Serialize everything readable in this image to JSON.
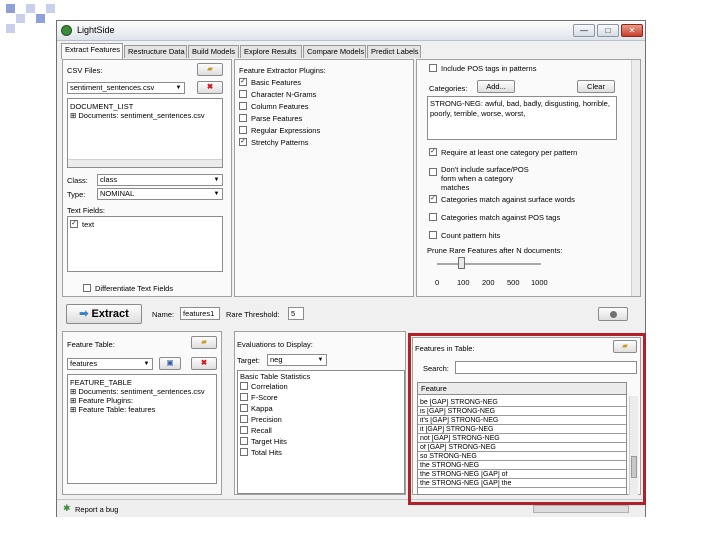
{
  "window": {
    "title": "LightSide",
    "btn_min": "—",
    "btn_max": "□",
    "btn_close": "✕"
  },
  "tabs": [
    "Extract Features",
    "Restructure Data",
    "Build Models",
    "Explore Results",
    "Compare Models",
    "Predict Labels"
  ],
  "left": {
    "csv_label": "CSV Files:",
    "csv_selected": "sentiment_sentences.csv",
    "doc_list": [
      "DOCUMENT_LIST",
      "Documents: sentiment_sentences.csv"
    ],
    "class_label": "Class:",
    "class_value": "class",
    "type_label": "Type:",
    "type_value": "NOMINAL",
    "text_fields_label": "Text Fields:",
    "text_field_item": "text",
    "differentiate": "Differentiate Text Fields"
  },
  "plugins": {
    "label": "Feature Extractor Plugins:",
    "items": [
      {
        "label": "Basic Features",
        "checked": true
      },
      {
        "label": "Character N-Grams",
        "checked": false
      },
      {
        "label": "Column Features",
        "checked": false
      },
      {
        "label": "Parse Features",
        "checked": false
      },
      {
        "label": "Regular Expressions",
        "checked": false
      },
      {
        "label": "Stretchy Patterns",
        "checked": true
      }
    ]
  },
  "right": {
    "include_pos": "Include POS tags in patterns",
    "categories_label": "Categories:",
    "add_label": "Add...",
    "clear_label": "Clear",
    "categories_text": "STRONG-NEG: awful, bad, badly, disgusting, horrible, poorly, terrible, worse, worst,",
    "options": [
      {
        "label": "Require at least one category per pattern",
        "checked": true
      },
      {
        "label": "Don't include surface/POS form when a category matches",
        "checked": false
      },
      {
        "label": "Categories match against surface words",
        "checked": true
      },
      {
        "label": "Categories match against POS tags",
        "checked": false
      },
      {
        "label": "Count pattern hits",
        "checked": false
      }
    ],
    "prune_label": "Prune Rare Features after N documents:",
    "slider_ticks": [
      "0",
      "100",
      "200",
      "500",
      "1000"
    ],
    "slider_value": 100
  },
  "extract_bar": {
    "extract_label": "Extract",
    "name_label": "Name:",
    "name_value": "features1",
    "threshold_label": "Rare Threshold:",
    "threshold_value": "5"
  },
  "bottom_left": {
    "label": "Feature Table:",
    "select_value": "features",
    "tree": [
      "FEATURE_TABLE",
      "Documents: sentiment_sentences.csv",
      "Feature Plugins:",
      "Feature Table: features"
    ]
  },
  "evaluations": {
    "label": "Evaluations to Display:",
    "target_label": "Target:",
    "target_value": "neg",
    "items": [
      "Basic Table Statistics",
      "Correlation",
      "F-Score",
      "Kappa",
      "Precision",
      "Recall",
      "Target Hits",
      "Total Hits"
    ]
  },
  "features_table": {
    "label": "Features in Table:",
    "search_label": "Search:",
    "search_value": "",
    "column": "Feature",
    "rows": [
      "be [GAP] STRONG-NEG",
      "is [GAP] STRONG-NEG",
      "it's [GAP] STRONG-NEG",
      "it [GAP] STRONG-NEG",
      "not [GAP] STRONG-NEG",
      "of [GAP] STRONG-NEG",
      "so STRONG-NEG",
      "the STRONG-NEG",
      "the STRONG-NEG [GAP] of",
      "the STRONG-NEG [GAP] the"
    ]
  },
  "status": {
    "report_bug": "Report a bug"
  },
  "colors": {
    "highlight": "#b22028",
    "window_bg": "#f0f0f0",
    "check": "#1a1a1a"
  }
}
